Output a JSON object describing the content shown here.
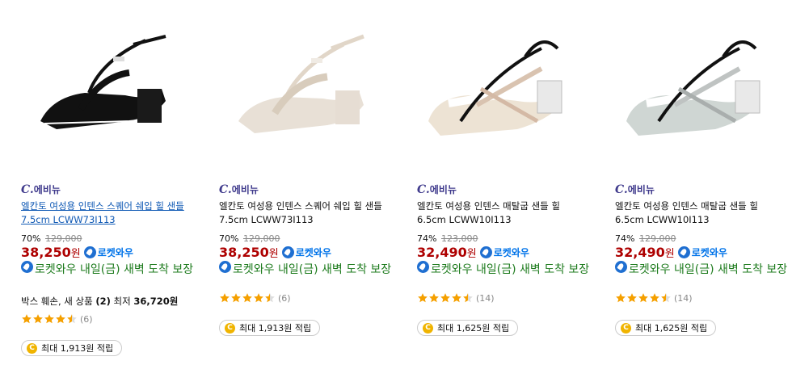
{
  "products": [
    {
      "brand": "에비뉴",
      "brand_prefix": "C.",
      "title": "엘칸토 여성용 인텐스 스퀘어 쉐입 힐 샌들 7.5cm LCWW73I113",
      "discount": "70%",
      "original_price": "129,000",
      "sale_price": "38,250",
      "won": "원",
      "rocket_label": "로켓와우",
      "delivery_text": "로켓와우 내일(금) 새벽 도착 보장",
      "extra_prefix": "박스 훼손, 새 상품",
      "extra_count": "(2)",
      "extra_low": "최저",
      "extra_price": "36,720원",
      "rating": 4.5,
      "review_count": "(6)",
      "cashback": "최대 1,913원 적립"
    },
    {
      "brand": "에비뉴",
      "brand_prefix": "C.",
      "title": "엘칸토 여성용 인텐스 스퀘어 쉐입 힐 샌들 7.5cm LCWW73I113",
      "discount": "70%",
      "original_price": "129,000",
      "sale_price": "38,250",
      "won": "원",
      "rocket_label": "로켓와우",
      "delivery_text": "로켓와우 내일(금) 새벽 도착 보장",
      "rating": 4.5,
      "review_count": "(6)",
      "cashback": "최대 1,913원 적립"
    },
    {
      "brand": "에비뉴",
      "brand_prefix": "C.",
      "title": "엘칸토 여성용 인텐스 매탈굽 샌들 힐 6.5cm LCWW10I113",
      "discount": "74%",
      "original_price": "123,000",
      "sale_price": "32,490",
      "won": "원",
      "rocket_label": "로켓와우",
      "delivery_text": "로켓와우 내일(금) 새벽 도착 보장",
      "rating": 4.5,
      "review_count": "(14)",
      "cashback": "최대 1,625원 적립"
    },
    {
      "brand": "에비뉴",
      "brand_prefix": "C.",
      "title": "엘칸토 여성용 인텐스 매탈굽 샌들 힐 6.5cm LCWW10I113",
      "discount": "74%",
      "original_price": "129,000",
      "sale_price": "32,490",
      "won": "원",
      "rocket_label": "로켓와우",
      "delivery_text": "로켓와우 내일(금) 새벽 도착 보장",
      "rating": 4.5,
      "review_count": "(14)",
      "cashback": "최대 1,625원 적립"
    }
  ],
  "colors": {
    "sale_price": "#ae0000",
    "rocket": "#0073e9",
    "delivery": "#1d7b1d",
    "brand": "#3f3a8c",
    "star": "#f5a000",
    "coin": "#f0b400"
  },
  "icons": {
    "rocket": "rocket-wow-icon",
    "star": "star-icon",
    "coin": "cash-coin-icon"
  }
}
